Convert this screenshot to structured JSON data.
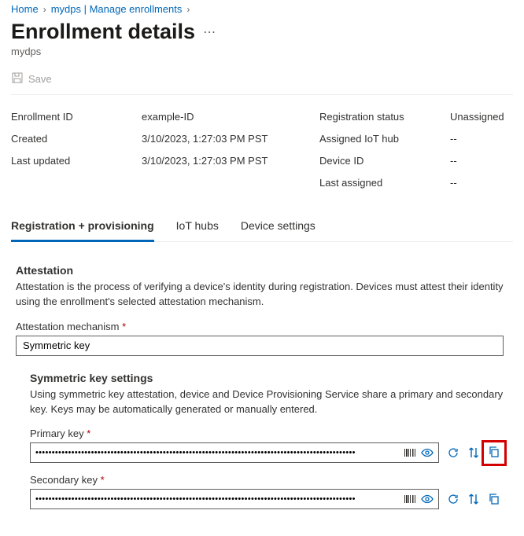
{
  "breadcrumb": {
    "home": "Home",
    "parent": "mydps | Manage enrollments"
  },
  "page": {
    "title": "Enrollment details",
    "subtitle": "mydps"
  },
  "toolbar": {
    "save": "Save"
  },
  "details": {
    "left_labels": {
      "enrollment_id": "Enrollment ID",
      "created": "Created",
      "last_updated": "Last updated"
    },
    "left_values": {
      "enrollment_id": "example-ID",
      "created": "3/10/2023, 1:27:03 PM PST",
      "last_updated": "3/10/2023, 1:27:03 PM PST"
    },
    "right_labels": {
      "reg_status": "Registration status",
      "assigned_hub": "Assigned IoT hub",
      "device_id": "Device ID",
      "last_assigned": "Last assigned"
    },
    "right_values": {
      "reg_status": "Unassigned",
      "assigned_hub": "--",
      "device_id": "--",
      "last_assigned": "--"
    }
  },
  "tabs": {
    "reg": "Registration + provisioning",
    "hubs": "IoT hubs",
    "device": "Device settings"
  },
  "attestation": {
    "title": "Attestation",
    "desc": "Attestation is the process of verifying a device's identity during registration. Devices must attest their identity using the enrollment's selected attestation mechanism.",
    "mechanism_label": "Attestation mechanism",
    "mechanism_value": "Symmetric key"
  },
  "sym": {
    "title": "Symmetric key settings",
    "desc": "Using symmetric key attestation, device and Device Provisioning Service share a primary and secondary key. Keys may be automatically generated or manually entered.",
    "primary_label": "Primary key",
    "secondary_label": "Secondary key",
    "masked": "••••••••••••••••••••••••••••••••••••••••••••••••••••••••••••••••••••••••••••••••••••••••••••••••••"
  }
}
